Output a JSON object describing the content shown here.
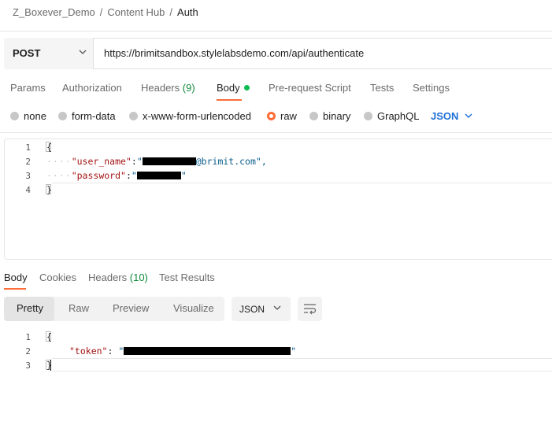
{
  "breadcrumb": {
    "items": [
      "Z_Boxever_Demo",
      "Content Hub",
      "Auth"
    ],
    "separator": "/"
  },
  "request": {
    "method": "POST",
    "url": "https://brimitsandbox.stylelabsdemo.com/api/authenticate"
  },
  "request_tabs": {
    "params": "Params",
    "authorization": "Authorization",
    "headers": "Headers",
    "headers_count": "(9)",
    "body": "Body",
    "prerequest": "Pre-request Script",
    "tests": "Tests",
    "settings": "Settings"
  },
  "body_types": {
    "none": "none",
    "form_data": "form-data",
    "urlencoded": "x-www-form-urlencoded",
    "raw": "raw",
    "binary": "binary",
    "graphql": "GraphQL",
    "selected": "raw",
    "language": "JSON"
  },
  "request_editor": {
    "line_numbers": [
      "1",
      "2",
      "3",
      "4"
    ],
    "open_brace": "{",
    "close_brace": "}",
    "user_name_key": "\"user_name\"",
    "user_name_value_suffix": "@brimit.com\",",
    "password_key": "\"password\"",
    "colon": ":",
    "quote": "\""
  },
  "response_tabs": {
    "body": "Body",
    "cookies": "Cookies",
    "headers": "Headers",
    "headers_count": "(10)",
    "test_results": "Test Results"
  },
  "response_view": {
    "pretty": "Pretty",
    "raw": "Raw",
    "preview": "Preview",
    "visualize": "Visualize",
    "format": "JSON"
  },
  "response_editor": {
    "line_numbers": [
      "1",
      "2",
      "3"
    ],
    "open_brace": "{",
    "close_brace": "}",
    "token_key": "\"token\"",
    "colon": ": ",
    "quote": "\""
  },
  "colors": {
    "accent": "#ff6c37",
    "link": "#1d6fd8",
    "count": "#0e8a3b",
    "status_dot": "#0cbb52"
  },
  "icons": [
    "chevron-down-icon",
    "status-dot-icon",
    "radio-icon",
    "wrap-lines-icon"
  ]
}
